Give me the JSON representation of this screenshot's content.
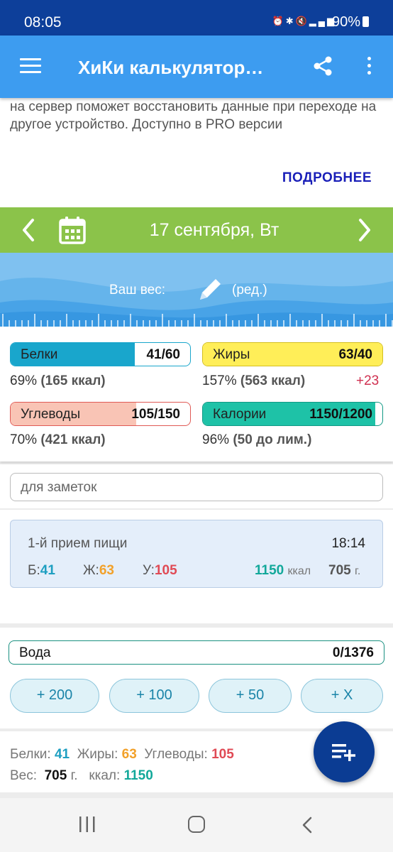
{
  "status_bar": {
    "time": "08:05",
    "battery": "90%",
    "icons": [
      "alarm-icon",
      "bluetooth-icon",
      "mute-icon",
      "4g-icon",
      "signal-icon",
      "signal-icon",
      "battery-icon"
    ]
  },
  "app_bar": {
    "title": "ХиКи калькулятор…",
    "icons": [
      "menu-icon",
      "share-icon",
      "more-vert-icon"
    ]
  },
  "promo": {
    "text": "на сервер поможет восстановить данные при переходе на другое устройство. Доступно в PRO версии",
    "more_label": "ПОДРОБНЕЕ"
  },
  "date_bar": {
    "date": "17 сентября, Вт",
    "icons": [
      "chevron-left-icon",
      "calendar-icon",
      "chevron-right-icon"
    ]
  },
  "weight": {
    "label": "Ваш вес:",
    "edit_label": "(ред.)"
  },
  "macros": {
    "protein": {
      "name": "Белки",
      "value": "41/60",
      "percent": "69%",
      "kcal": "(165 ккал)",
      "fill_fraction": 0.69,
      "color": "#19a6cc"
    },
    "fat": {
      "name": "Жиры",
      "value": "63/40",
      "percent": "157%",
      "kcal": "(563 ккал)",
      "over": "+23",
      "fill_fraction": 1.0,
      "color": "#ffee58"
    },
    "carbs": {
      "name": "Углеводы",
      "value": "105/150",
      "percent": "70%",
      "kcal": "(421 ккал)",
      "fill_fraction": 0.7,
      "color": "#f9c4b5"
    },
    "calories": {
      "name": "Калории",
      "value": "1150/1200",
      "percent": "96%",
      "kcal": "(50 до лим.)",
      "fill_fraction": 0.96,
      "color": "#1ec2a7"
    }
  },
  "notes": {
    "placeholder": "для заметок"
  },
  "meal": {
    "title": "1-й прием пищи",
    "time": "18:14",
    "protein_label": "Б:",
    "protein": "41",
    "fat_label": "Ж:",
    "fat": "63",
    "carbs_label": "У:",
    "carbs": "105",
    "kcal": "1150",
    "kcal_unit": "ккал",
    "weight": "705",
    "weight_unit": "г."
  },
  "water": {
    "label": "Вода",
    "value": "0/1376",
    "buttons": [
      "+ 200",
      "+ 100",
      "+ 50",
      "+ X"
    ]
  },
  "totals": {
    "protein_label": "Белки:",
    "protein": "41",
    "fat_label": "Жиры:",
    "fat": "63",
    "carbs_label": "Углеводы:",
    "carbs": "105",
    "weight_label": "Вес:",
    "weight": "705",
    "weight_unit": "г.",
    "kcal_label": "ккал:",
    "kcal": "1150"
  },
  "fab": {
    "icon": "add-to-list-icon"
  },
  "nav": {
    "icons": [
      "recents-icon",
      "home-icon",
      "back-icon"
    ]
  }
}
